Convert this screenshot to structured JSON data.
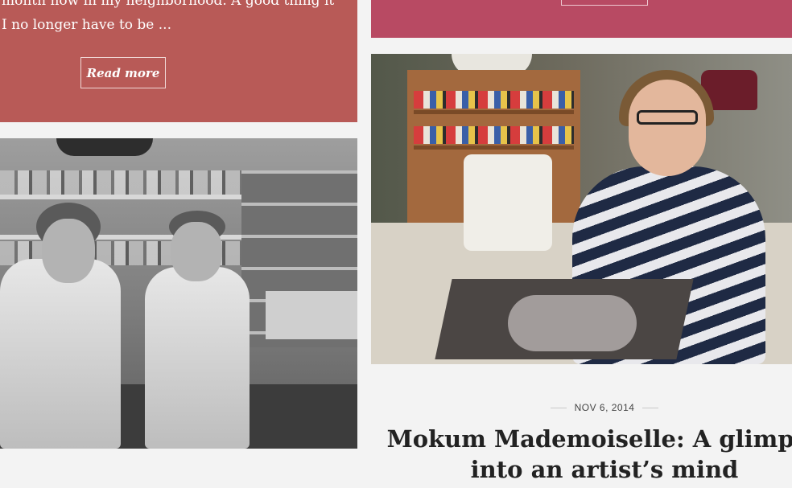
{
  "cards": {
    "top_left": {
      "excerpt_line1": "month now in my neighborhood. A good thing it",
      "excerpt_line2": "I no longer have to be ...",
      "read_more_label": "Read more"
    },
    "top_right": {
      "read_more_label": ""
    }
  },
  "photos": {
    "chefs_alt": "",
    "sewing_alt": ""
  },
  "post": {
    "date": "NOV 6, 2014",
    "title_line1": "Mokum Mademoiselle: A glimpse",
    "title_line2": "into an artist’s mind"
  },
  "colors": {
    "card_left_bg": "#b85a57",
    "card_right_bg": "#b84a63",
    "page_bg": "#f3f3f3"
  }
}
